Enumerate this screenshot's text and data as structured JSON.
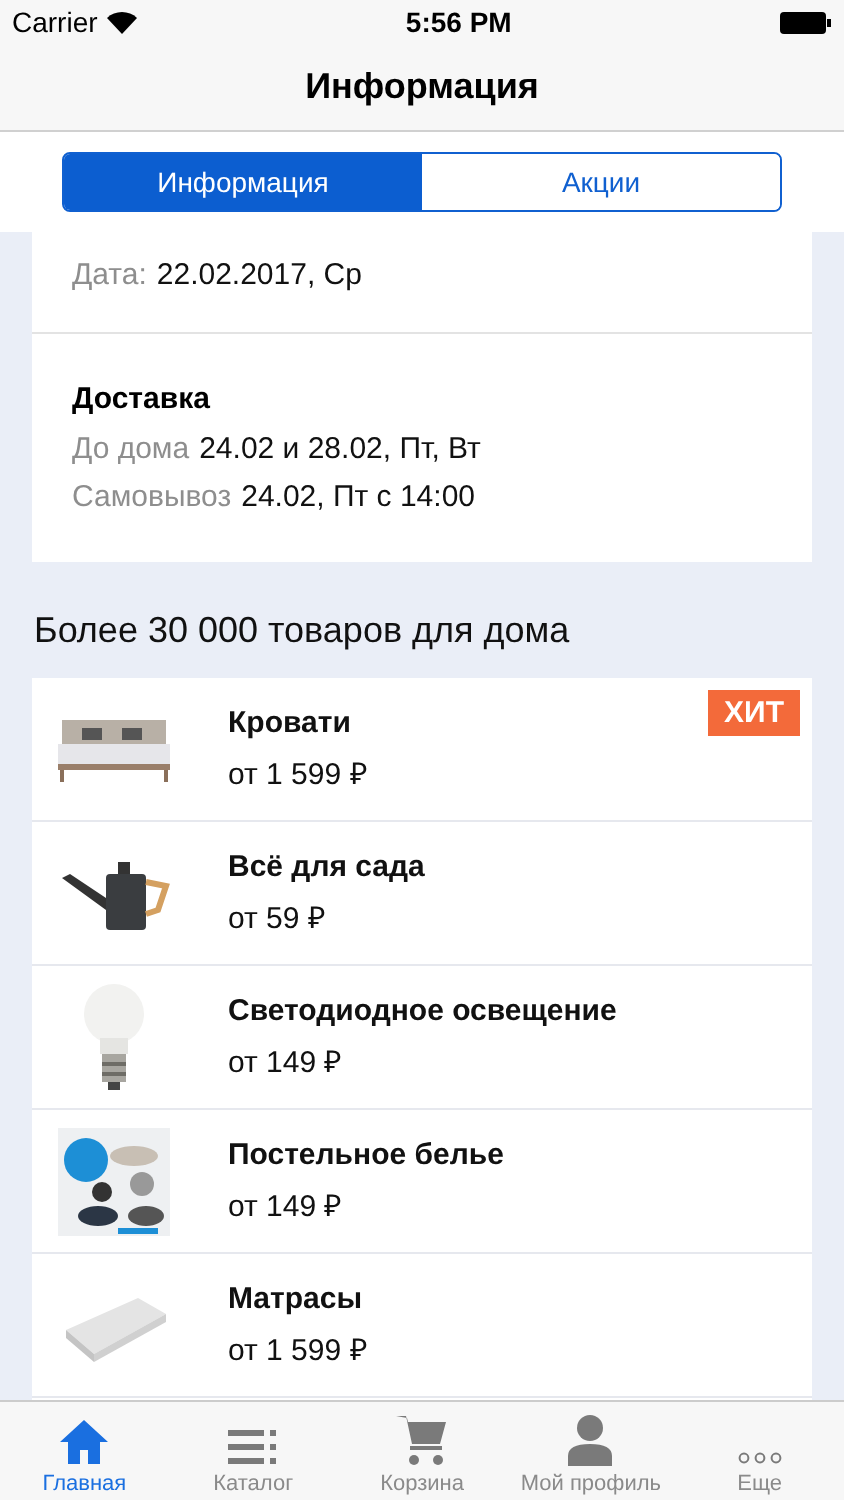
{
  "status_bar": {
    "carrier": "Carrier",
    "time": "5:56 PM"
  },
  "nav": {
    "title": "Информация"
  },
  "segments": [
    {
      "label": "Информация",
      "selected": true
    },
    {
      "label": "Акции",
      "selected": false
    }
  ],
  "store": {
    "lines": [
      {
        "label": "Дата:",
        "value": "22.02.2017, Ср"
      }
    ]
  },
  "delivery": {
    "title": "Доставка",
    "lines": [
      {
        "label": "До дома",
        "value": "24.02 и 28.02, Пт, Вт"
      },
      {
        "label": "Самовывоз",
        "value": "24.02, Пт с 14:00"
      }
    ]
  },
  "section_title": "Более 30 000 товаров для дома",
  "products": [
    {
      "name": "Кровати",
      "price": "от 1 599 ₽",
      "badge": "ХИТ",
      "kind": "picture"
    },
    {
      "name": "Всё для сада",
      "price": "от 59 ₽",
      "kind": "picture"
    },
    {
      "name": "Светодиодное освещение",
      "price": "от 149 ₽",
      "kind": "picture"
    },
    {
      "name": "Постельное белье",
      "price": "от 149 ₽",
      "kind": "picture"
    },
    {
      "name": "Матрасы",
      "price": "от 1 599 ₽",
      "kind": "picture"
    }
  ],
  "tab_bar": [
    {
      "label": "Главная",
      "selected": true
    },
    {
      "label": "Каталог",
      "selected": false
    },
    {
      "label": "Корзина",
      "selected": false
    },
    {
      "label": "Мой профиль",
      "selected": false
    },
    {
      "label": "Еще",
      "selected": false
    }
  ]
}
